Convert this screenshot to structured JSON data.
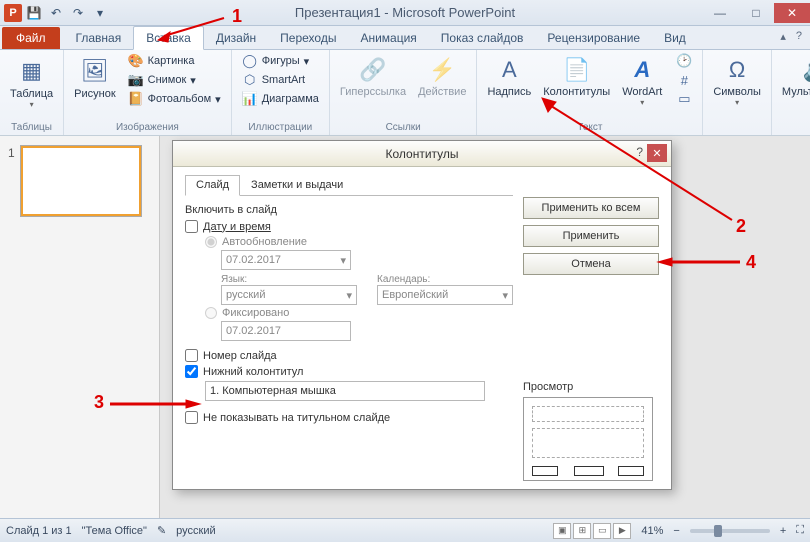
{
  "title": "Презентация1 - Microsoft PowerPoint",
  "qat": {
    "save": "💾",
    "undo": "↶",
    "redo": "↷"
  },
  "tabs": {
    "file": "Файл",
    "items": [
      "Главная",
      "Вставка",
      "Дизайн",
      "Переходы",
      "Анимация",
      "Показ слайдов",
      "Рецензирование",
      "Вид"
    ],
    "active_index": 1
  },
  "ribbon": {
    "tables": {
      "btn": "Таблица",
      "group": "Таблицы"
    },
    "images": {
      "pic": "Рисунок",
      "clipart": "Картинка",
      "screenshot": "Снимок",
      "album": "Фотоальбом",
      "group": "Изображения"
    },
    "illus": {
      "shapes": "Фигуры",
      "smartart": "SmartArt",
      "chart": "Диаграмма",
      "group": "Иллюстрации"
    },
    "links": {
      "hyper": "Гиперссылка",
      "action": "Действие",
      "group": "Ссылки"
    },
    "text": {
      "textbox": "Надпись",
      "headerfooter": "Колонтитулы",
      "wordart": "WordArt",
      "group": "Текст"
    },
    "symbols": {
      "btn": "Символы"
    },
    "media": {
      "btn": "Мультимедиа"
    }
  },
  "thumb": {
    "num": "1"
  },
  "dialog": {
    "title": "Колонтитулы",
    "tab_slide": "Слайд",
    "tab_notes": "Заметки и выдачи",
    "include_label": "Включить в слайд",
    "datetime": "Дату и время",
    "auto": "Автообновление",
    "date_value": "07.02.2017",
    "lang_label": "Язык:",
    "lang_value": "русский",
    "cal_label": "Календарь:",
    "cal_value": "Европейский",
    "fixed": "Фиксировано",
    "fixed_value": "07.02.2017",
    "slidenum": "Номер слайда",
    "footer": "Нижний колонтитул",
    "footer_value": "1. Компьютерная мышка",
    "noshow": "Не показывать на титульном слайде",
    "apply_all": "Применить ко всем",
    "apply": "Применить",
    "cancel": "Отмена",
    "preview": "Просмотр"
  },
  "status": {
    "slide": "Слайд 1 из 1",
    "theme": "\"Тема Office\"",
    "lang": "русский",
    "zoom": "41%"
  },
  "annotations": {
    "n1": "1",
    "n2": "2",
    "n3": "3",
    "n4": "4"
  }
}
